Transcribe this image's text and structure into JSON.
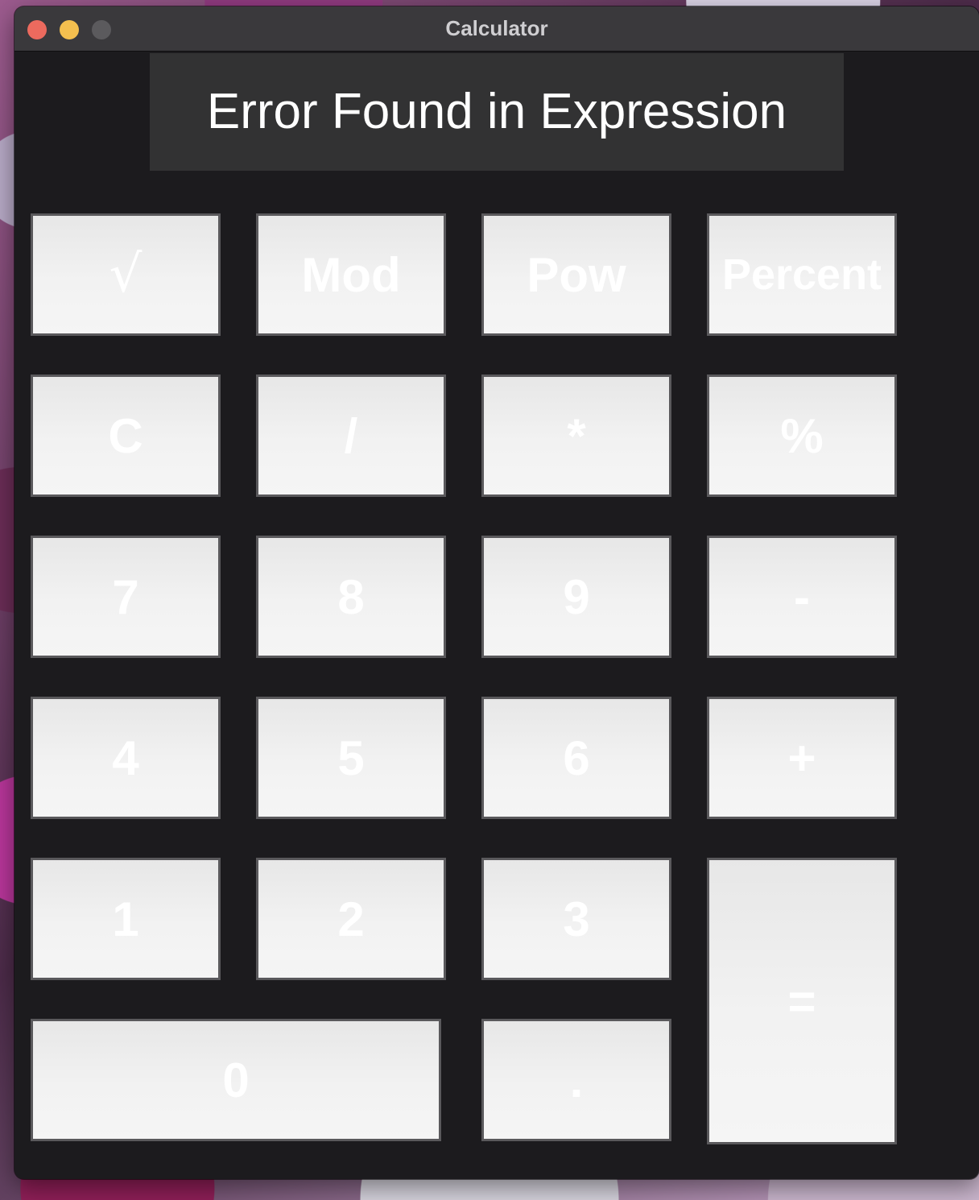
{
  "window": {
    "title": "Calculator"
  },
  "display": {
    "text": "Error Found in Expression"
  },
  "keys": {
    "sqrt": "√",
    "mod": "Mod",
    "pow": "Pow",
    "percent_word": "Percent",
    "clear": "C",
    "divide": "/",
    "multiply": "*",
    "percent": "%",
    "seven": "7",
    "eight": "8",
    "nine": "9",
    "minus": "-",
    "four": "4",
    "five": "5",
    "six": "6",
    "plus": "+",
    "one": "1",
    "two": "2",
    "three": "3",
    "equals": "=",
    "zero": "0",
    "decimal": "."
  }
}
